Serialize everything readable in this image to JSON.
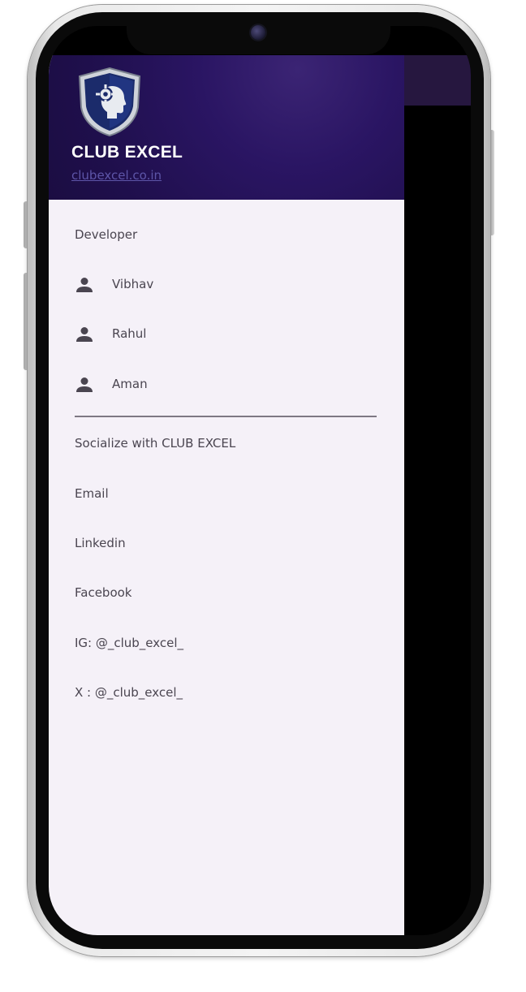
{
  "drawer": {
    "header": {
      "title": "CLUB EXCEL",
      "link": "clubexcel.co.in",
      "logo_icon": "shield-head-gear-icon"
    },
    "developer_section": {
      "label": "Developer",
      "items": [
        {
          "icon": "person-icon",
          "label": "Vibhav"
        },
        {
          "icon": "person-icon",
          "label": "Rahul"
        },
        {
          "icon": "person-icon",
          "label": "Aman"
        }
      ]
    },
    "social_section": {
      "label": "Socialize with CLUB EXCEL",
      "items": [
        {
          "label": "Email"
        },
        {
          "label": "Linkedin"
        },
        {
          "label": "Facebook"
        },
        {
          "label": "IG: @_club_excel_"
        },
        {
          "label": "X : @_club_excel_"
        }
      ]
    }
  },
  "colors": {
    "header_bg": "#1f0f4c",
    "drawer_bg": "#f5f1f8",
    "link": "#5d55a8",
    "text": "#4a4550",
    "icon": "#4a4550"
  }
}
